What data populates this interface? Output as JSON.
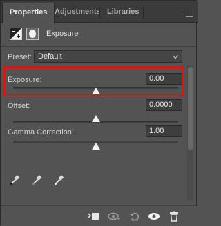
{
  "tabs": [
    {
      "label": "Properties",
      "active": true
    },
    {
      "label": "Adjustments",
      "active": false
    },
    {
      "label": "Libraries",
      "active": false
    }
  ],
  "header": {
    "title": "Exposure",
    "adjustment_icon": "exposure-adjustment-icon",
    "mask_icon": "layer-mask-icon"
  },
  "preset": {
    "label": "Preset:",
    "value": "Default"
  },
  "sliders": [
    {
      "label": "Exposure:",
      "value": "0.00",
      "position": 0.5
    },
    {
      "label": "Offset:",
      "value": "0.0000",
      "position": 0.5
    },
    {
      "label": "Gamma Correction:",
      "value": "1.00",
      "position": 0.5
    }
  ],
  "highlight_color": "#e21212",
  "eyedroppers": [
    "black-point-eyedropper-icon",
    "gray-point-eyedropper-icon",
    "white-point-eyedropper-icon"
  ],
  "bottom_bar": [
    "clip-to-layer-icon",
    "view-previous-state-icon",
    "reset-icon",
    "visibility-eye-icon",
    "trash-icon"
  ]
}
